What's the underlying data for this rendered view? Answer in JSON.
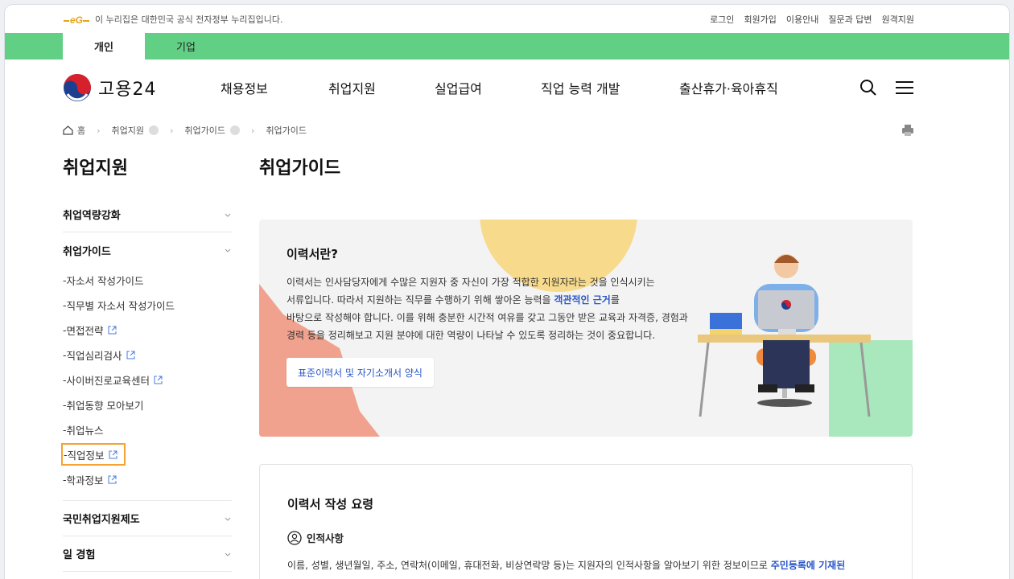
{
  "gov_banner": {
    "text": "이 누리집은 대한민국 공식 전자정부 누리집입니다."
  },
  "utility_links": [
    "로그인",
    "회원가입",
    "이용안내",
    "질문과 답변",
    "원격지원"
  ],
  "user_tabs": [
    "개인",
    "기업"
  ],
  "logo": {
    "text": "고용24"
  },
  "main_menu": [
    "채용정보",
    "취업지원",
    "실업급여",
    "직업 능력 개발",
    "출산휴가·육아휴직"
  ],
  "breadcrumb": [
    "홈",
    "취업지원",
    "취업가이드",
    "취업가이드"
  ],
  "sidebar": {
    "title": "취업지원",
    "groups": [
      {
        "label": "취업역량강화"
      },
      {
        "label": "취업가이드"
      },
      {
        "label": "국민취업지원제도"
      },
      {
        "label": "일 경험"
      }
    ],
    "sub_items": [
      "자소서 작성가이드",
      "직무별 자소서 작성가이드",
      "면접전략",
      "직업심리검사",
      "사이버진로교육센터",
      "취업동향 모아보기",
      "취업뉴스",
      "직업정보",
      "학과정보"
    ]
  },
  "content": {
    "title": "취업가이드",
    "hero": {
      "title": "이력서란?",
      "p1": "이력서는 인사담당자에게 수많은 지원자 중 자신이 가장 적합한 지원자라는 것을 인식시키는",
      "p2a": "서류입니다. 따라서 지원하는 직무를 수행하기 위해 쌓아온 능력을 ",
      "p2kw": "객관적인 근거",
      "p2b": "를",
      "p3": "바탕으로 작성해야 합니다. 이를 위해 충분한 시간적 여유를 갖고 그동안 받은 교육과 자격증, 경험과",
      "p4": "경력 등을 정리해보고 지원 분야에 대한 역량이 나타날 수 있도록 정리하는 것이 중요합니다.",
      "button": "표준이력서 및 자기소개서 양식"
    },
    "card": {
      "title": "이력서 작성 요령",
      "sub": "인적사항",
      "p_a": "이름, 성별, 생년월일, 주소, 연락처(이메일, 휴대전화, 비상연락망 등)는 지원자의 인적사항을 알아보기 위한 정보이므로 ",
      "p_kw": "주민등록에 기재된"
    }
  },
  "colors": {
    "brand_green": "#61cf84",
    "link_blue": "#2a56c6",
    "highlight_orange": "#f5a233"
  }
}
